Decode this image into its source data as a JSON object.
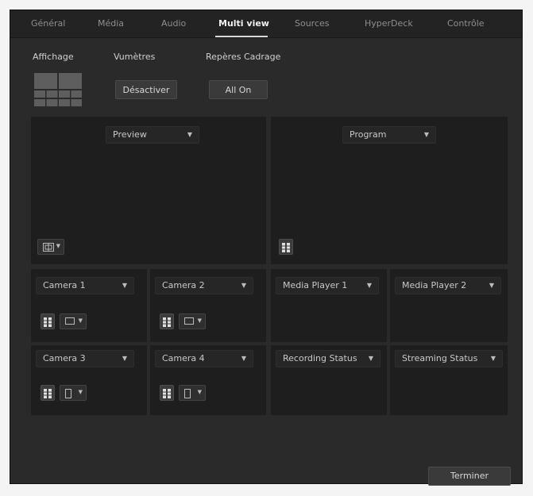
{
  "tabs": [
    {
      "label": "Général"
    },
    {
      "label": "Média"
    },
    {
      "label": "Audio"
    },
    {
      "label": "Multi view",
      "active": true
    },
    {
      "label": "Sources"
    },
    {
      "label": "HyperDeck"
    },
    {
      "label": "Contrôle"
    }
  ],
  "sections": {
    "layout_label": "Affichage",
    "meters_label": "Vumètres",
    "safe_area_label": "Repères Cadrage",
    "meters_button": "Désactiver",
    "safe_area_button": "All On"
  },
  "windows": {
    "preview": "Preview",
    "program": "Program",
    "cam1": "Camera 1",
    "cam2": "Camera 2",
    "mp1": "Media Player 1",
    "mp2": "Media Player 2",
    "cam3": "Camera 3",
    "cam4": "Camera 4",
    "rec": "Recording Status",
    "stream": "Streaming Status"
  },
  "footer": {
    "done_button": "Terminer"
  },
  "colors": {
    "background": "#2a2a2a",
    "panel": "#1e1e1e",
    "text": "#c9c9c9"
  },
  "icons": [
    "layout-grid-icon",
    "safe-area-icon",
    "audio-meter-icon",
    "monitor-icon",
    "portrait-icon",
    "chevron-down-icon"
  ]
}
